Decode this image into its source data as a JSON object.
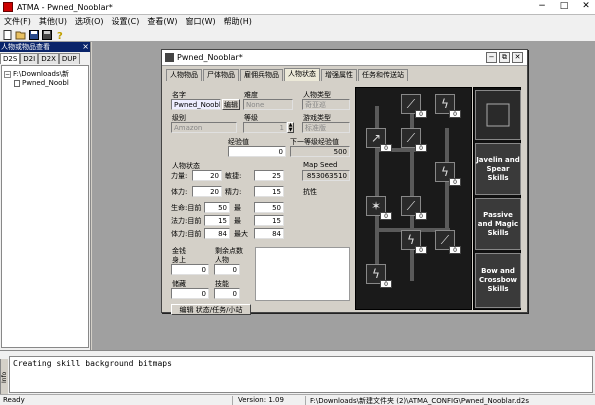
{
  "app": {
    "title": "ATMA - Pwned_Nooblar*"
  },
  "menu": [
    "文件(F)",
    "其他(U)",
    "选项(O)",
    "设置(C)",
    "查看(W)",
    "窗口(W)",
    "帮助(H)"
  ],
  "toolbar": {
    "icons": [
      "new-icon",
      "open-icon",
      "save-icon",
      "save-all-icon",
      "help-icon"
    ]
  },
  "left_panel": {
    "title": "人物或物品查看",
    "close": "×",
    "tabs": [
      "D2S",
      "D2I",
      "D2X",
      "DUP"
    ],
    "active_tab": "D2S",
    "tree": {
      "root": "F:\\Downloads\\新",
      "child": "Pwned_Noobl"
    }
  },
  "child_window": {
    "title": "Pwned_Nooblar*",
    "tabs": [
      "人物物品",
      "尸体物品",
      "雇佣兵物品",
      "人物状态",
      "增强属性",
      "任务和传送站"
    ],
    "active_tab": "人物状态"
  },
  "status": {
    "name_label": "名字",
    "name_value": "Pwned_Nooblar",
    "edit_button": "编辑",
    "difficulty_label": "难度",
    "difficulty_value": "None",
    "char_type_label": "人物类型",
    "char_type_value": "奇亚巡",
    "class_label": "级别",
    "class_value": "Amazon",
    "level_label": "等级",
    "level_value": "1",
    "game_type_label": "游戏类型",
    "game_type_value": "标准版",
    "xp_label": "经验值",
    "xp_value": "0",
    "next_xp_label": "下一等级经验值",
    "next_xp_value": "500",
    "stats_header": "人物状态",
    "map_seed_label": "Map Seed",
    "map_seed_value": "853063510",
    "resist_label": "抗性",
    "strength_label": "力量:",
    "strength_value": "20",
    "dexterity_label": "敏捷:",
    "dexterity_value": "25",
    "vitality_label": "体力:",
    "vitality_value": "20",
    "energy_label": "精力:",
    "energy_value": "15",
    "life_label": "生命:目前",
    "life_current": "50",
    "life_max_label": "最",
    "life_max": "50",
    "mana_label": "法力:目前",
    "mana_current": "15",
    "mana_max_label": "最",
    "mana_max": "15",
    "stamina_label": "体力:目前",
    "stamina_current": "84",
    "stamina_max_label": "最大",
    "stamina_max": "84",
    "gold_label": "金钱",
    "gold_body_label": "身上",
    "gold_body": "0",
    "gold_stash_label": "储藏",
    "gold_stash": "0",
    "remaining_label": "剩余点数",
    "remaining_stat_label": "人物",
    "remaining_stat": "0",
    "remaining_skill_label": "技能",
    "remaining_skill": "0",
    "edit_status_button": "编辑 状态/任务/小站"
  },
  "skills": {
    "points": [
      "0",
      "0",
      "0",
      "0",
      "0",
      "0",
      "0",
      "0",
      "0",
      "0"
    ],
    "tabs": [
      "Javelin and Spear Skills",
      "Passive and Magic Skills",
      "Bow and Crossbow Skills"
    ],
    "icons": [
      "spear-icon",
      "lightning-icon",
      "javelin-icon",
      "spear-icon",
      "lightning-icon",
      "fury-icon",
      "spear-icon",
      "lightning-icon",
      "spear-icon",
      "lightning-icon"
    ]
  },
  "log": {
    "info_label": "Info",
    "message": "Creating skill background bitmaps"
  },
  "statusbar": {
    "ready": "Ready",
    "version": "Version: 1.09",
    "path": "F:\\Downloads\\新建文件夹 (2)\\ATMA_CONFIG\\Pwned_Nooblar.d2s"
  }
}
